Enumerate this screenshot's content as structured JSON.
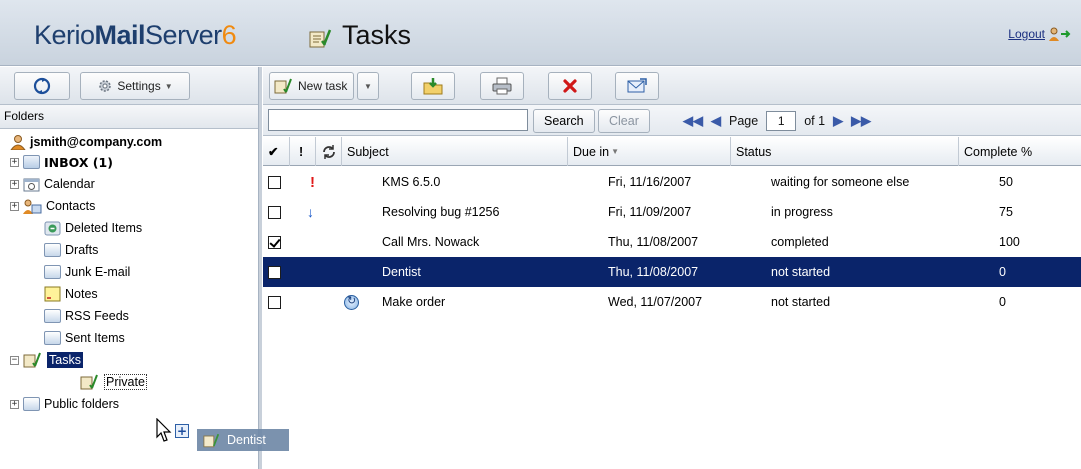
{
  "header": {
    "logo_part1": "Kerio",
    "logo_part2": "Mail",
    "logo_part3": "Server",
    "logo_version": "6",
    "title": "Tasks",
    "logout": "Logout"
  },
  "left_toolbar": {
    "settings": "Settings"
  },
  "folders": {
    "heading": "Folders",
    "account": "jsmith@company.com",
    "items": [
      {
        "label": "INBOX (1)",
        "icon": "folder-open-icon"
      },
      {
        "label": "Calendar",
        "icon": "calendar-icon"
      },
      {
        "label": "Contacts",
        "icon": "contacts-icon"
      },
      {
        "label": "Deleted Items",
        "icon": "deleted-items-icon"
      },
      {
        "label": "Drafts",
        "icon": "folder-icon"
      },
      {
        "label": "Junk E-mail",
        "icon": "folder-icon"
      },
      {
        "label": "Notes",
        "icon": "notes-icon"
      },
      {
        "label": "RSS Feeds",
        "icon": "folder-icon"
      },
      {
        "label": "Sent Items",
        "icon": "folder-icon"
      },
      {
        "label": "Tasks",
        "icon": "tasks-icon"
      },
      {
        "label": "Private",
        "icon": "tasks-icon"
      },
      {
        "label": "Public folders",
        "icon": "folder-icon"
      }
    ]
  },
  "toolbar": {
    "new_task": "New task"
  },
  "search": {
    "value": "",
    "search_button": "Search",
    "clear_button": "Clear",
    "page_label": "Page",
    "page_value": "1",
    "of_label": "of 1"
  },
  "grid": {
    "columns": [
      "✔",
      "!",
      "",
      "Subject",
      "Due in",
      "Status",
      "Complete %"
    ],
    "rows": [
      {
        "done": false,
        "priority": "high",
        "recurring": false,
        "subject": "KMS 6.5.0",
        "due": "Fri, 11/16/2007",
        "status": "waiting for someone else",
        "complete": "50"
      },
      {
        "done": false,
        "priority": "low",
        "recurring": false,
        "subject": "Resolving bug #1256",
        "due": "Fri, 11/09/2007",
        "status": "in progress",
        "complete": "75"
      },
      {
        "done": true,
        "priority": "normal",
        "recurring": false,
        "subject": "Call Mrs. Nowack",
        "due": "Thu, 11/08/2007",
        "status": "completed",
        "complete": "100"
      },
      {
        "done": false,
        "priority": "normal",
        "recurring": false,
        "subject": "Dentist",
        "due": "Thu, 11/08/2007",
        "status": "not started",
        "complete": "0",
        "selected": true
      },
      {
        "done": false,
        "priority": "normal",
        "recurring": true,
        "subject": "Make order",
        "due": "Wed, 11/07/2007",
        "status": "not started",
        "complete": "0"
      }
    ]
  },
  "drag": {
    "label": "Dentist"
  },
  "colors": {
    "selection": "#0a246a",
    "brand_blue": "#1e3f6e",
    "brand_orange": "#f08a10",
    "priority_high": "#e01818",
    "priority_low": "#1656c8"
  }
}
